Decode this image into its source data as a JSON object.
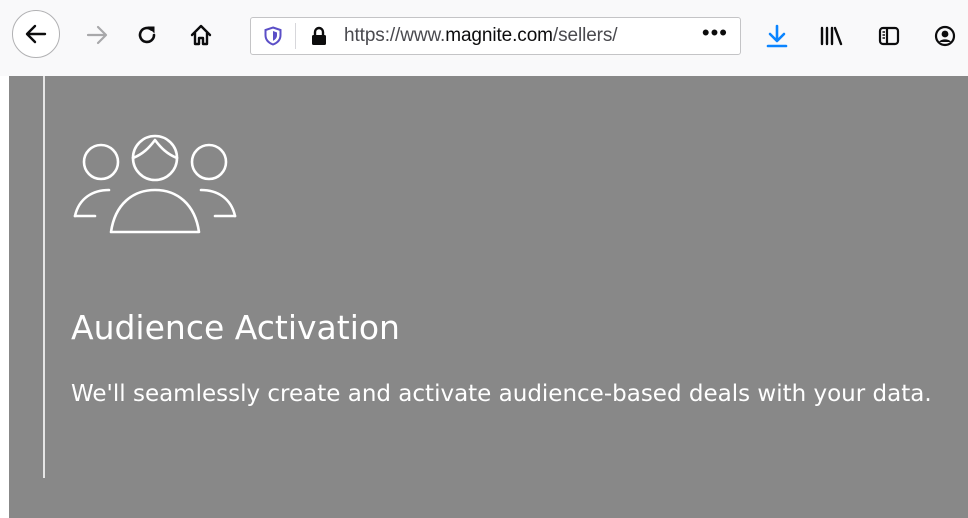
{
  "browser": {
    "url_prefix": "https://www.",
    "url_domain": "magnite.com",
    "url_path": "/sellers/",
    "url_more": "•••",
    "icons": {
      "back": "arrow-left-icon",
      "forward": "arrow-right-icon",
      "reload": "reload-icon",
      "home": "home-icon",
      "tracking": "shield-icon",
      "secure": "lock-icon",
      "download": "download-icon",
      "library": "library-icon",
      "sidebar": "sidebar-icon",
      "account": "account-icon"
    },
    "colors": {
      "download_accent": "#0a84ff",
      "shield_accent": "#5b4fc7"
    }
  },
  "feature": {
    "icon": "people-group-icon",
    "title": "Audience Activation",
    "description": "We'll seamlessly create and activate audience-based deals with your data."
  },
  "colors": {
    "content_background": "#888888",
    "text": "#ffffff"
  }
}
